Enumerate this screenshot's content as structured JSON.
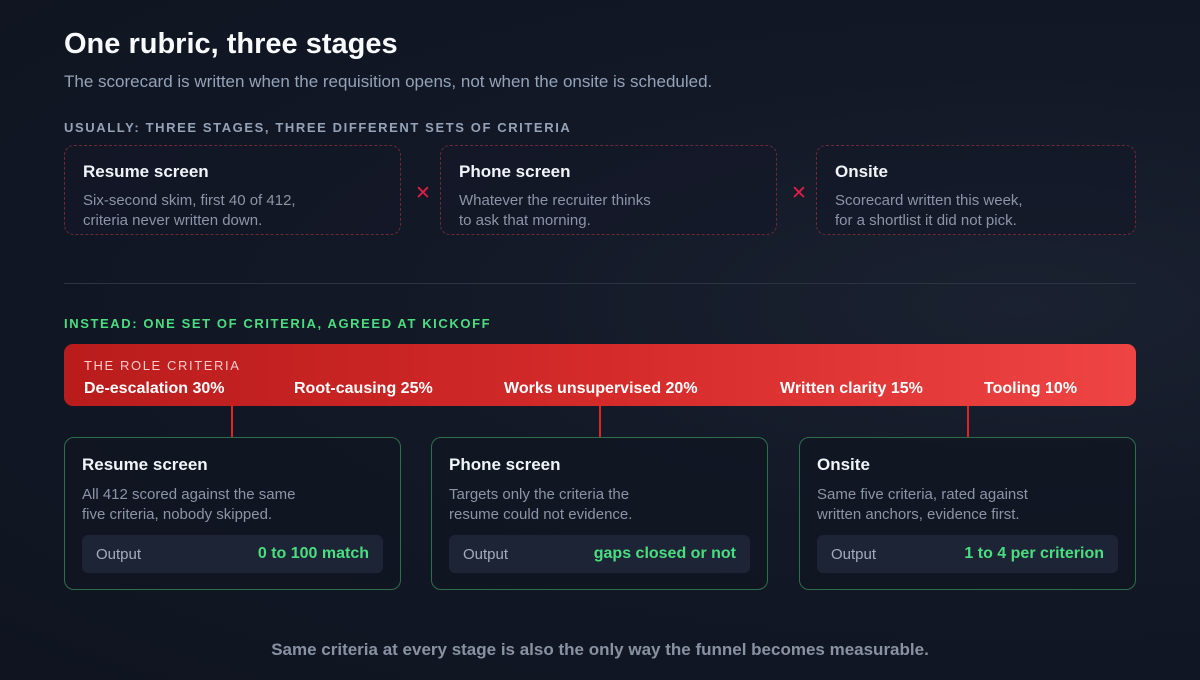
{
  "header": {
    "title": "One rubric, three stages",
    "subtitle": "The scorecard is written when the requisition opens, not when the onsite is scheduled."
  },
  "usually": {
    "label": "USUALLY: THREE STAGES, THREE DIFFERENT SETS OF CRITERIA",
    "separator": "✕",
    "stages": [
      {
        "title": "Resume screen",
        "desc": "Six-second skim, first 40 of 412,\ncriteria never written down."
      },
      {
        "title": "Phone screen",
        "desc": "Whatever the recruiter thinks\nto ask that morning."
      },
      {
        "title": "Onsite",
        "desc": "Scorecard written this week,\nfor a shortlist it did not pick."
      }
    ]
  },
  "instead": {
    "label": "INSTEAD: ONE SET OF CRITERIA, AGREED AT KICKOFF",
    "criteria_bar": {
      "label": "THE ROLE CRITERIA",
      "items": [
        "De-escalation 30%",
        "Root-causing 25%",
        "Works unsupervised 20%",
        "Written clarity 15%",
        "Tooling 10%"
      ]
    },
    "stages": [
      {
        "title": "Resume screen",
        "desc": "All 412 scored against the same\nfive criteria, nobody skipped.",
        "output_label": "Output",
        "output_value": "0 to 100 match"
      },
      {
        "title": "Phone screen",
        "desc": "Targets only the criteria the\nresume could not evidence.",
        "output_label": "Output",
        "output_value": "gaps closed or not"
      },
      {
        "title": "Onsite",
        "desc": "Same five criteria, rated against\nwritten anchors, evidence first.",
        "output_label": "Output",
        "output_value": "1 to 4 per criterion"
      }
    ]
  },
  "footer": "Same criteria at every stage is also the only way the funnel becomes measurable.",
  "colors": {
    "accent_red": "#dc2626",
    "accent_green": "#4ade80",
    "background": "#121826"
  }
}
